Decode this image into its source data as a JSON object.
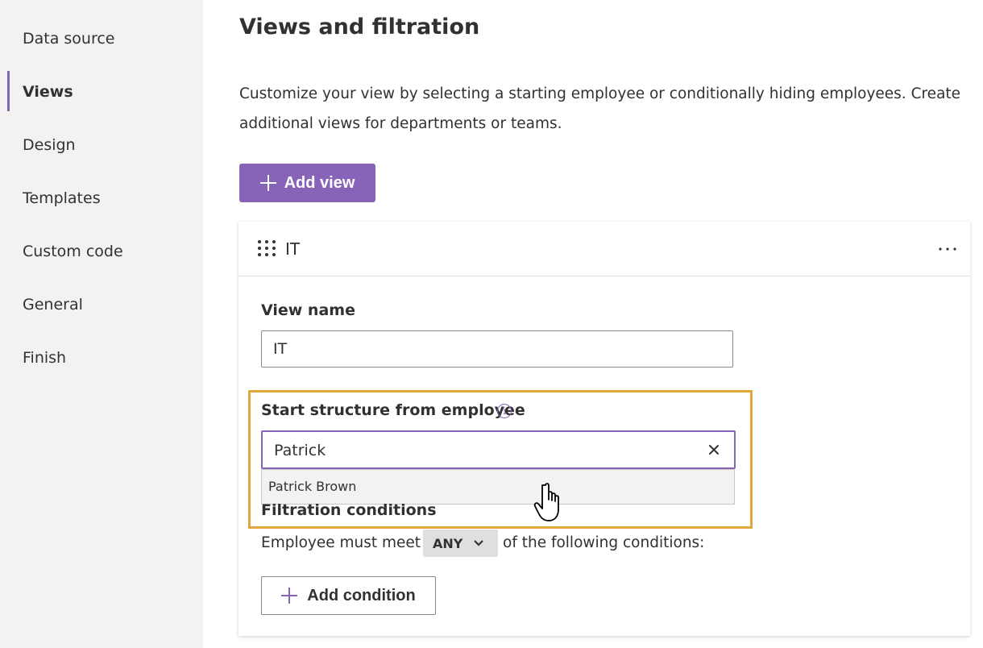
{
  "sidebar": {
    "items": [
      {
        "label": "Data source",
        "active": false
      },
      {
        "label": "Views",
        "active": true
      },
      {
        "label": "Design",
        "active": false
      },
      {
        "label": "Templates",
        "active": false
      },
      {
        "label": "Custom code",
        "active": false
      },
      {
        "label": "General",
        "active": false
      },
      {
        "label": "Finish",
        "active": false
      }
    ]
  },
  "main": {
    "title": "Views and filtration",
    "description": "Customize your view by selecting a starting employee or conditionally hiding employees. Create additional views for departments or teams.",
    "add_view_label": "Add view",
    "view_card": {
      "title": "IT",
      "more_icon": "more-horizontal-icon",
      "view_name_label": "View name",
      "view_name_value": "IT",
      "start_label": "Start structure from employee",
      "start_value": "Patrick",
      "suggestion": "Patrick Brown",
      "filtration_label": "Filtration conditions",
      "condition_prefix": "Employee must meet",
      "condition_mode": "ANY",
      "condition_suffix": "of the following conditions:",
      "add_condition_label": "Add condition"
    }
  },
  "colors": {
    "accent": "#8764b8",
    "sidebar_bg": "#f3f2f1",
    "highlight": "#e0a73c"
  }
}
